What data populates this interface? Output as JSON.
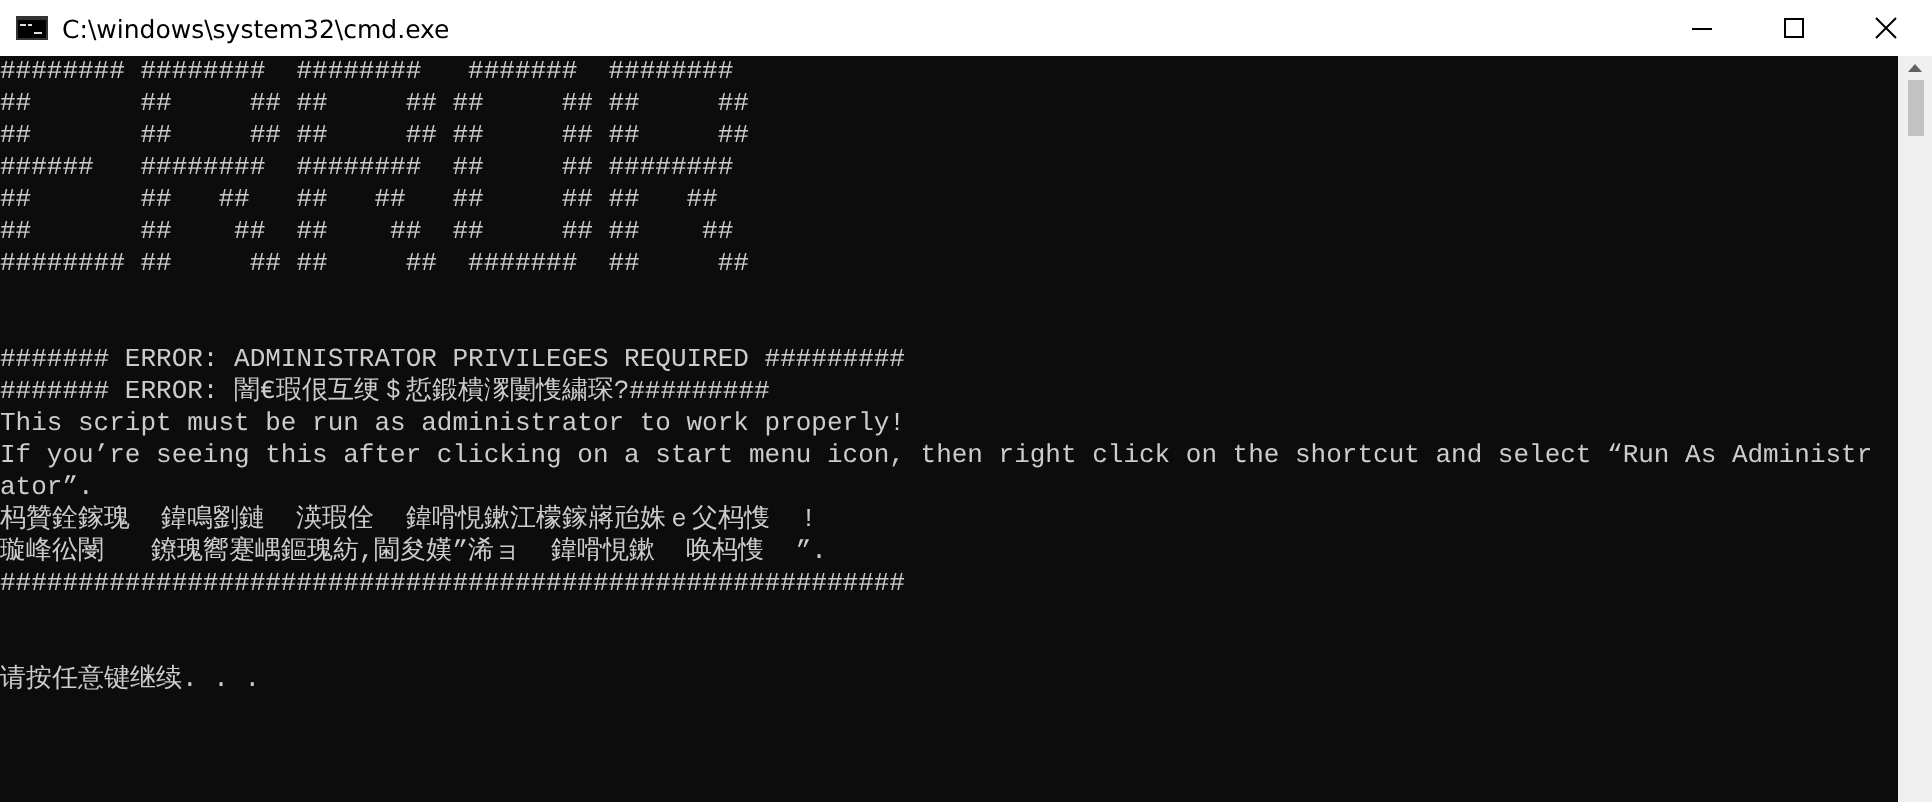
{
  "window": {
    "title": "C:\\windows\\system32\\cmd.exe"
  },
  "console": {
    "blocks": [
      {
        "lines": [
          "######## ########  ########   #######  ########",
          "##       ##     ## ##     ## ##     ## ##     ##",
          "##       ##     ## ##     ## ##     ## ##     ##",
          "######   ########  ########  ##     ## ########",
          "##       ##   ##   ##   ##   ##     ## ##   ##",
          "##       ##    ##  ##    ##  ##     ## ##    ##",
          "######## ##     ## ##     ##  #######  ##     ##"
        ]
      },
      {
        "lines": [
          "####### ERROR: ADMINISTRATOR PRIVILEGES REQUIRED #########",
          "####### ERROR: 闇€瑕佷互绠＄悊鍛樻潈闄愯繍琛?#########",
          "This script must be run as administrator to work properly!",
          "If you’re seeing this after clicking on a start menu icon, then right click on the shortcut and select “Run As Administr",
          "ator”.",
          "杩贊銓鎵瑰  鍏鳴劉鏈  渶瑕佺  鍏嗗悓鏉江檬鎵嶈兘姝ｅ父杩愯  !",
          "璇峰彸閿   鐐瑰嚮蹇嵎鏂瑰紡,閫夋嫨”浠ョ  鍏嗗悓鏉  唤杩愯  ”.",
          "##########################################################"
        ]
      },
      {
        "lines": [
          "请按任意键继续. . ."
        ]
      }
    ]
  }
}
